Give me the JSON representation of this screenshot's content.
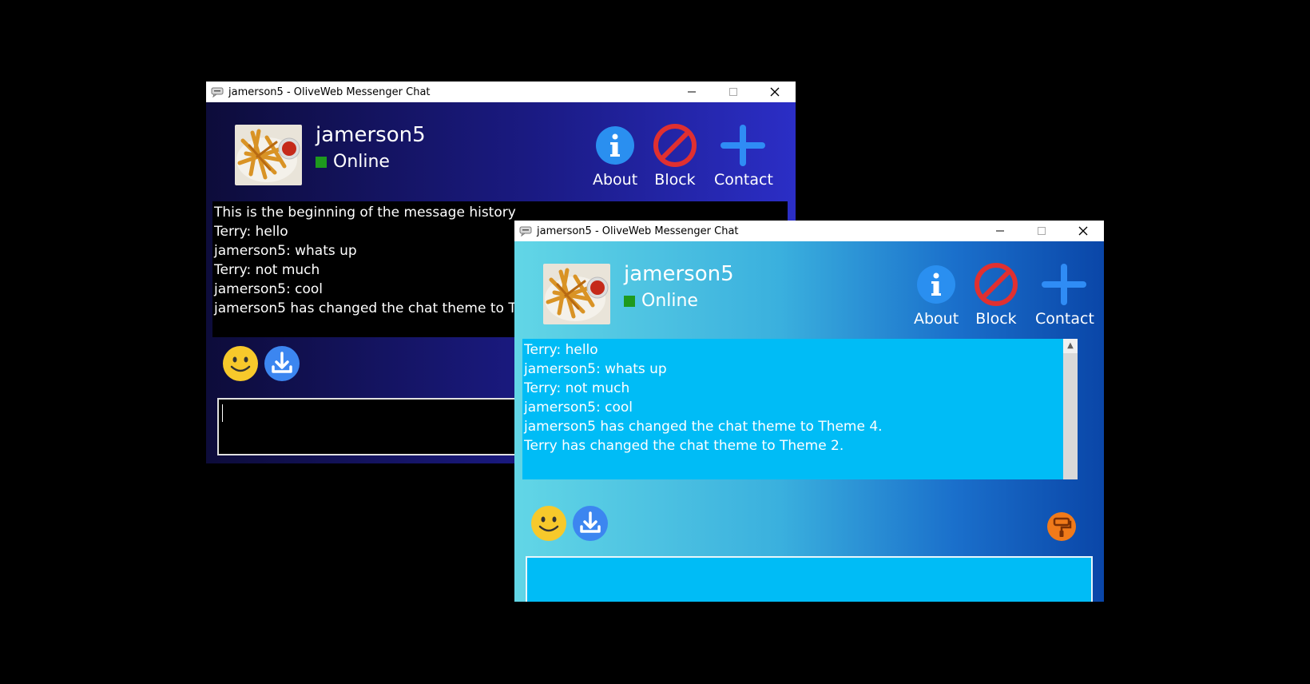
{
  "windows": {
    "back": {
      "title": "jamerson5 - OliveWeb Messenger Chat",
      "username": "jamerson5",
      "status": "Online",
      "actions": {
        "about": "About",
        "block": "Block",
        "contact": "Contact"
      },
      "messages": [
        "This is the beginning of the message history",
        "Terry: hello",
        "jamerson5: whats up",
        "Terry: not much",
        "jamerson5: cool",
        "jamerson5 has changed the chat theme to Theme 4."
      ],
      "composer_value": ""
    },
    "front": {
      "title": "jamerson5 - OliveWeb Messenger Chat",
      "username": "jamerson5",
      "status": "Online",
      "actions": {
        "about": "About",
        "block": "Block",
        "contact": "Contact"
      },
      "messages": [
        "Terry: hello",
        "jamerson5: whats up",
        "Terry: not much",
        "jamerson5: cool",
        "jamerson5 has changed the chat theme to Theme 4.",
        "Terry has changed the chat theme to Theme 2."
      ],
      "composer_value": ""
    }
  },
  "icons": {
    "title_app": "chat-bubble-icon",
    "minimize": "minimize-icon",
    "maximize": "maximize-icon",
    "close": "close-icon",
    "about": "info-icon",
    "block": "block-icon",
    "contact": "plus-icon",
    "emoji": "smiley-icon",
    "download": "download-icon",
    "theme": "paint-roller-icon",
    "avatar": "fries-photo"
  },
  "colors": {
    "online": "#1e9a1e",
    "info_blue": "#2a8ff0",
    "block_red": "#e03030",
    "contact_blue": "#2f8cf5",
    "theme_orange": "#f07a1a"
  }
}
